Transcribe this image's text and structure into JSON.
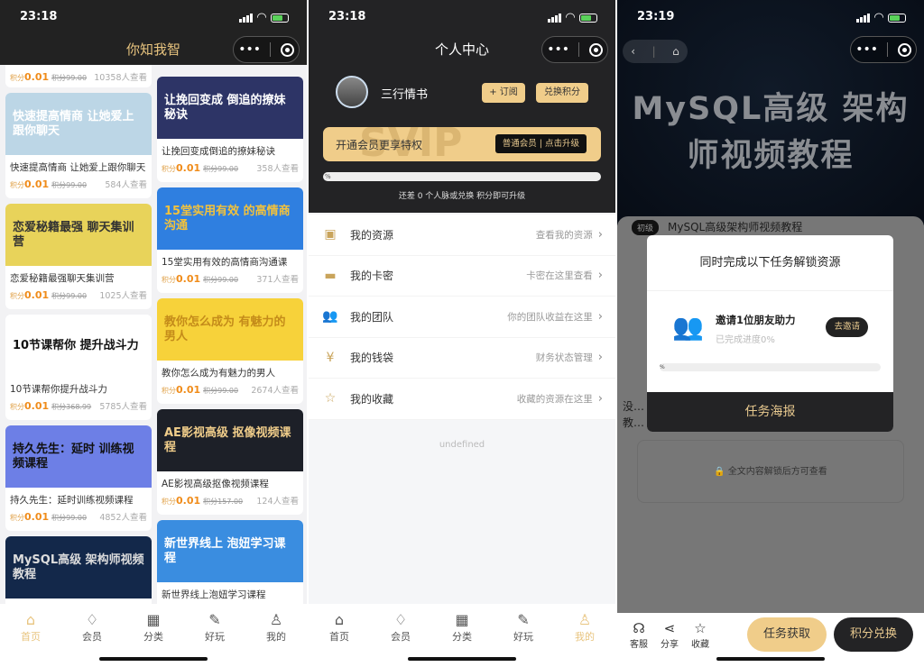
{
  "colors": {
    "gold": "#f0cd8a",
    "dark": "#232325",
    "price": "#f08c1a"
  },
  "home": {
    "time": "23:18",
    "title": "你知我智",
    "top_partial": {
      "label": "积分",
      "price": "0.01",
      "original": "积分99.00",
      "views": "10358人查看"
    },
    "left": [
      {
        "banner": "快速提高情商 让她爱上跟你聊天",
        "title": "快速提高情商 让她爱上跟你聊天",
        "label": "积分",
        "price": "0.01",
        "original": "积分99.00",
        "views": "584人查看",
        "bg": "#bcd6e6",
        "fg": "#fff"
      },
      {
        "banner": "恋爱秘籍最强 聊天集训营",
        "title": "恋爱秘籍最强聊天集训营",
        "label": "积分",
        "price": "0.01",
        "original": "积分99.00",
        "views": "1025人查看",
        "bg": "#e8d35a",
        "fg": "#333"
      },
      {
        "banner": "10节课帮你 提升战斗力",
        "title": "10节课帮你提升战斗力",
        "label": "积分",
        "price": "0.01",
        "original": "积分368.99",
        "views": "5785人查看",
        "bg": "#ffffff",
        "fg": "#111"
      },
      {
        "banner": "持久先生：延时 训练视频课程",
        "title": "持久先生：延时训练视频课程",
        "label": "积分",
        "price": "0.01",
        "original": "积分99.00",
        "views": "4852人查看",
        "bg": "#6d7fe6",
        "fg": "#111"
      },
      {
        "banner": "MySQL高级 架构师视频教程",
        "title": "",
        "bg": "#13284a",
        "fg": "#ddd"
      }
    ],
    "right": [
      {
        "banner": "让挽回变成 倒追的撩妹秘诀",
        "title": "让挽回变成倒追的撩妹秘诀",
        "label": "积分",
        "price": "0.01",
        "original": "积分99.00",
        "views": "358人查看",
        "bg": "#2d3466",
        "fg": "#fff"
      },
      {
        "banner": "15堂实用有效 的高情商沟通",
        "title": "15堂实用有效的高情商沟通课",
        "label": "积分",
        "price": "0.01",
        "original": "积分99.00",
        "views": "371人查看",
        "bg": "#2f7fe0",
        "fg": "#f2c23c"
      },
      {
        "banner": "教你怎么成为 有魅力的男人",
        "title": "教你怎么成为有魅力的男人",
        "label": "积分",
        "price": "0.01",
        "original": "积分99.00",
        "views": "2674人查看",
        "bg": "#f7d23a",
        "fg": "#c48b1a"
      },
      {
        "banner": "AE影视高级 抠像视频课程",
        "title": "AE影视高级抠像视频课程",
        "label": "积分",
        "price": "0.01",
        "original": "积分157.00",
        "views": "124人查看",
        "bg": "#1d2028",
        "fg": "#f0cd8a"
      },
      {
        "banner": "新世界线上 泡妞学习课程",
        "title": "新世界线上泡妞学习课程",
        "bg": "#3a8de0",
        "fg": "#fff"
      }
    ]
  },
  "tabs": [
    {
      "label": "首页",
      "icon": "home-icon",
      "glyph": "⌂"
    },
    {
      "label": "会员",
      "icon": "diamond-icon",
      "glyph": "♢"
    },
    {
      "label": "分类",
      "icon": "grid-icon",
      "glyph": "▦"
    },
    {
      "label": "好玩",
      "icon": "pin-icon",
      "glyph": "✎"
    },
    {
      "label": "我的",
      "icon": "user-icon",
      "glyph": "♙"
    }
  ],
  "profile": {
    "time": "23:18",
    "title": "个人中心",
    "username": "三行情书",
    "subscribe": "+ 订阅",
    "exchange": "兑换积分",
    "vip_text": "开通会员更享特权",
    "vip_watermark": "SVIP",
    "vip_button": "普通会员 | 点击升级",
    "progress_label": "%",
    "progress": 0,
    "progress_text": "还差 0 个人脉或兑换 积分即可升级",
    "menu": [
      {
        "label": "我的资源",
        "hint": "查看我的资源",
        "icon": "folder-icon",
        "glyph": "▣"
      },
      {
        "label": "我的卡密",
        "hint": "卡密在这里查看",
        "icon": "card-key-icon",
        "glyph": "▬"
      },
      {
        "label": "我的团队",
        "hint": "你的团队收益在这里",
        "icon": "team-icon",
        "glyph": "👥"
      },
      {
        "label": "我的钱袋",
        "hint": "财务状态管理",
        "icon": "money-bag-icon",
        "glyph": "¥"
      },
      {
        "label": "我的收藏",
        "hint": "收藏的资源在这里",
        "icon": "star-icon",
        "glyph": "☆"
      }
    ],
    "footer": "undefined"
  },
  "detail": {
    "time": "23:19",
    "banner": "MySQL高级 架构师视频教程",
    "tag": "初级",
    "title": "MySQL高级架构师视频教程",
    "desc": "没… 教…",
    "locked": "全文内容解锁后方可查看",
    "modal": {
      "title": "同时完成以下任务解锁资源",
      "task": "邀请1位朋友助力",
      "progress_text": "已完成进度0%",
      "progress": 0,
      "progress_label": "%",
      "invite": "去邀请",
      "footer": "任务海报"
    },
    "bottom": [
      {
        "label": "客服",
        "icon": "customer-service-icon",
        "glyph": "☊"
      },
      {
        "label": "分享",
        "icon": "share-icon",
        "glyph": "⋖"
      },
      {
        "label": "收藏",
        "icon": "star-icon",
        "glyph": "☆"
      }
    ],
    "task_button": "任务获取",
    "points_button": "积分兑换"
  }
}
